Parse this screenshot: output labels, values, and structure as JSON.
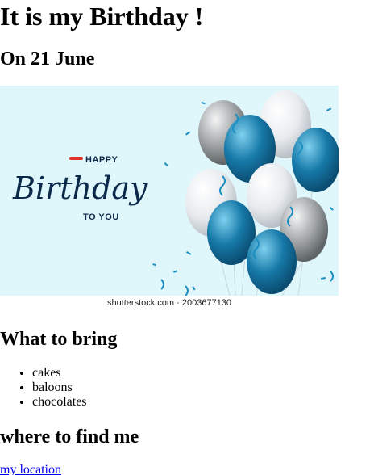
{
  "heading": "It is my Birthday !",
  "date_heading": "On 21 June",
  "banner": {
    "happy_text": "HAPPY",
    "birthday_text": "Birthday",
    "to_you_text": "TO YOU",
    "caption": "shutterstock.com · 2003677130",
    "colors": {
      "background": "#dff6fb",
      "script": "#0b2a4a",
      "accent": "#e0322b",
      "teal": "#1679a8",
      "silver": "#9aa0a4",
      "white_balloon": "#eef0f2"
    }
  },
  "bring": {
    "title": "What to bring",
    "items": [
      "cakes",
      "baloons",
      "chocolates"
    ]
  },
  "find": {
    "title": "where to find me",
    "link_label": "my location"
  }
}
